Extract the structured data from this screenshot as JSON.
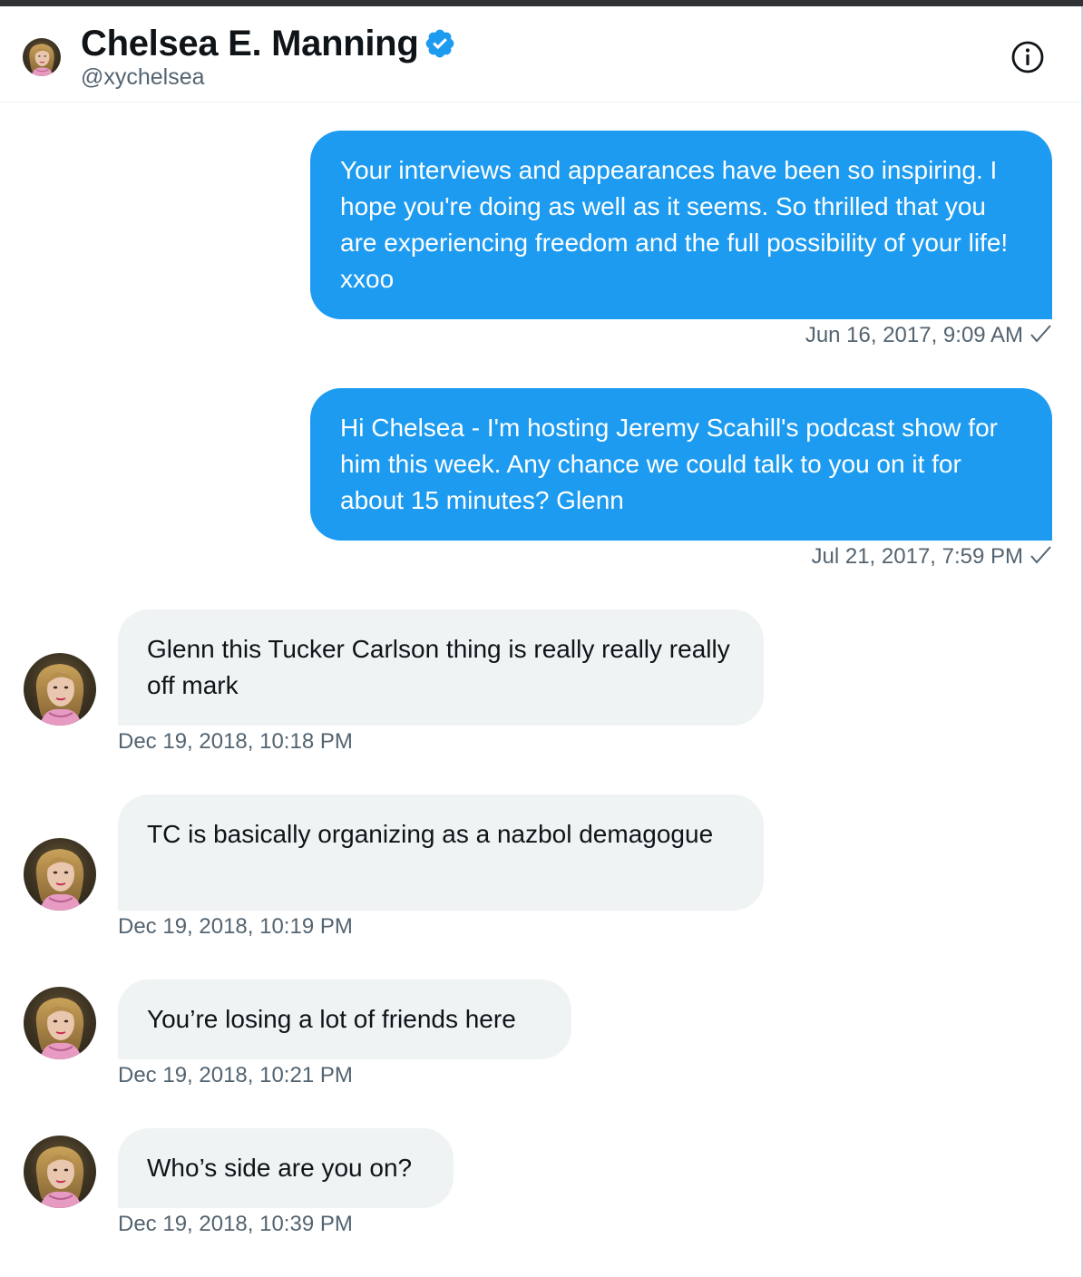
{
  "header": {
    "name": "Chelsea E. Manning",
    "handle": "@xychelsea",
    "verified": true
  },
  "colors": {
    "outgoing_bubble": "#1d9bf0",
    "incoming_bubble": "#eff3f4",
    "timestamp": "#536471"
  },
  "messages": [
    {
      "direction": "outgoing",
      "text": "Your interviews and appearances have been so inspiring. I hope you're doing as well as it seems. So thrilled that you are experiencing freedom and the full possibility of your life! xxoo",
      "timestamp": "Jun 16, 2017, 9:09 AM",
      "status_icon": "check-icon"
    },
    {
      "direction": "outgoing",
      "text": "Hi Chelsea - I'm hosting Jeremy Scahill's podcast show for him this week. Any chance we could talk to you on it for about 15 minutes? Glenn",
      "timestamp": "Jul 21, 2017, 7:59 PM",
      "status_icon": "check-icon"
    },
    {
      "direction": "incoming",
      "text": "Glenn this Tucker Carlson thing is really really really off mark",
      "timestamp": "Dec 19, 2018, 10:18 PM"
    },
    {
      "direction": "incoming",
      "text": "TC is basically organizing as a nazbol demagogue",
      "timestamp": "Dec 19, 2018, 10:19 PM"
    },
    {
      "direction": "incoming",
      "text": "You’re losing a lot of friends here",
      "timestamp": "Dec 19, 2018, 10:21 PM"
    },
    {
      "direction": "incoming",
      "text": "Who’s side are you on?",
      "timestamp": "Dec 19, 2018, 10:39 PM"
    }
  ]
}
